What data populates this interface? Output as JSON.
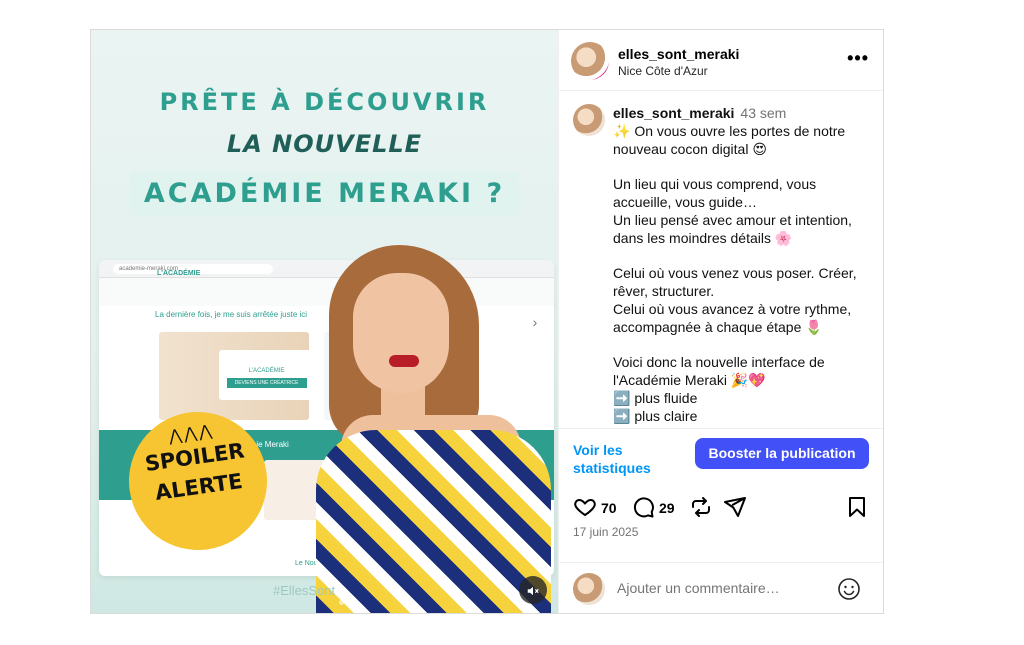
{
  "post": {
    "media": {
      "headline_line1": "PRÊTE À DÉCOUVRIR",
      "headline_line2": "LA NOUVELLE",
      "headline_line3": "ACADÉMIE MERAKI ?",
      "browser_url": "academie-meraki.com",
      "site_logo": "L'ACADÉMIE",
      "site_note": "La dernière fois, je me suis arrêtée juste ici",
      "card_title": "L'ACADÉMIE",
      "card_button": "DEVIENS UNE CRÉATRICE",
      "band_label": "Académie Meraki",
      "sub_label": "Le Nouve",
      "badge_line1": "SPOILER",
      "badge_line2": "ALERTE",
      "hashtag": "#EllesSont",
      "mute_icon": "speaker-mute-icon",
      "next_icon": "chevron-right-icon"
    },
    "header": {
      "username": "elles_sont_meraki",
      "location": "Nice Côte d'Azur",
      "more_label": "•••"
    },
    "caption": {
      "username": "elles_sont_meraki",
      "time": "43 sem",
      "lines": [
        "✨ On vous ouvre les portes de notre nouveau cocon digital 😍",
        "",
        "Un lieu qui vous comprend, vous accueille, vous guide…\nUn lieu pensé avec amour et intention, dans les moindres détails 🌸",
        "",
        "Celui où vous venez vous poser. Créer, rêver, structurer.\nCelui où vous avancez à votre rythme, accompagnée à chaque étape 🌷",
        "",
        "Voici donc la nouvelle interface de l'Académie Meraki 🎉💖\n➡️ plus fluide\n➡️ plus claire"
      ]
    },
    "actions": {
      "stats_label": "Voir les statistiques",
      "boost_label": "Booster la publication",
      "likes": "70",
      "comments": "29",
      "date": "17 juin 2025"
    },
    "comment": {
      "placeholder": "Ajouter un commentaire…"
    },
    "colors": {
      "accent": "#2e9e8f",
      "boost": "#4150f7",
      "link": "#0095f6",
      "badge": "#f7c531"
    }
  }
}
